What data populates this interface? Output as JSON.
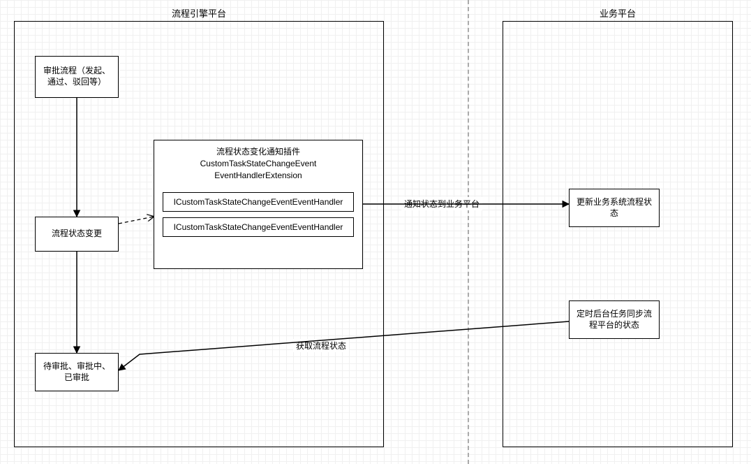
{
  "title_left": "流程引擎平台",
  "title_right": "业务平台",
  "nodes": {
    "approval_flow": "审批流程（发起、通过、驳回等）",
    "state_change": "流程状态变更",
    "final_states": "待审批、审批中、已审批",
    "update_biz": "更新业务系统流程状态",
    "scheduled_sync": "定时后台任务同步流程平台的状态"
  },
  "plugin": {
    "title_line1": "流程状态变化通知插件",
    "title_line2": "CustomTaskStateChangeEvent",
    "title_line3": "EventHandlerExtension",
    "handler1": "ICustomTaskStateChangeEventEventHandler",
    "handler2": "ICustomTaskStateChangeEventEventHandler"
  },
  "edges": {
    "notify_label": "通知状态到业务平台",
    "fetch_label": "获取流程状态"
  }
}
